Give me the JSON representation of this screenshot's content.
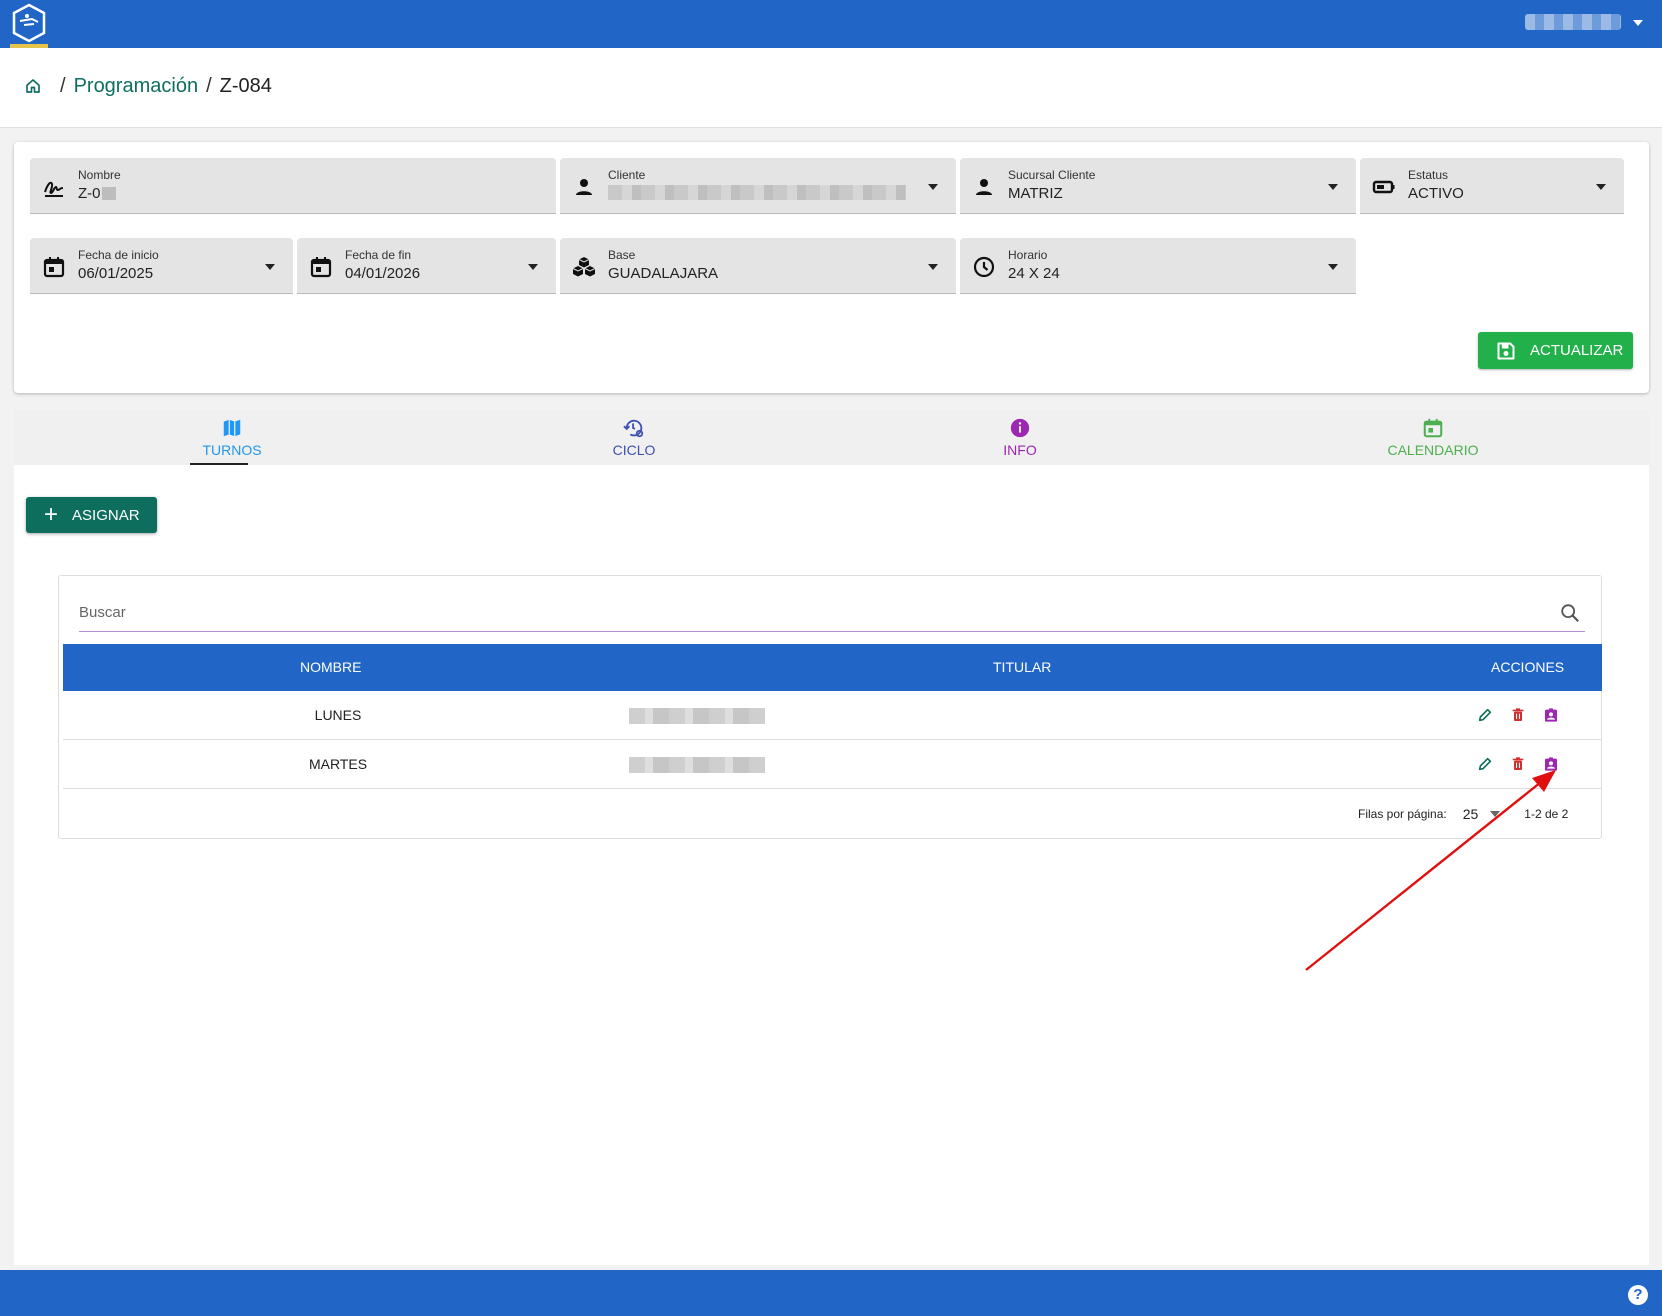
{
  "breadcrumb": {
    "home_icon": "home-icon",
    "parent": "Programación",
    "current": "Z-084"
  },
  "form": {
    "nombre": {
      "label": "Nombre",
      "value": "Z-0"
    },
    "cliente": {
      "label": "Cliente"
    },
    "sucursal": {
      "label": "Sucursal Cliente",
      "value": "MATRIZ"
    },
    "estatus": {
      "label": "Estatus",
      "value": "ACTIVO"
    },
    "fecha_inicio": {
      "label": "Fecha de inicio",
      "value": "06/01/2025"
    },
    "fecha_fin": {
      "label": "Fecha de fin",
      "value": "04/01/2026"
    },
    "base": {
      "label": "Base",
      "value": "GUADALAJARA"
    },
    "horario": {
      "label": "Horario",
      "value": "24 X 24"
    },
    "update_label": "ACTUALIZAR"
  },
  "tabs": [
    {
      "label": "TURNOS",
      "color": "#2196f3"
    },
    {
      "label": "CICLO",
      "color": "#3f51b5"
    },
    {
      "label": "INFO",
      "color": "#9c27b0"
    },
    {
      "label": "CALENDARIO",
      "color": "#4caf50"
    }
  ],
  "assign_label": "ASIGNAR",
  "search": {
    "placeholder": "Buscar"
  },
  "table": {
    "headers": [
      "NOMBRE",
      "TITULAR",
      "ACCIONES"
    ],
    "rows": [
      {
        "nombre": "LUNES"
      },
      {
        "nombre": "MARTES"
      }
    ]
  },
  "pagination": {
    "rows_per_page_label": "Filas por página:",
    "rows_per_page": "25",
    "range": "1-2 de 2"
  },
  "colors": {
    "primary": "#2166c6",
    "accent_green": "#22b04a",
    "teal": "#0d6e5e"
  }
}
